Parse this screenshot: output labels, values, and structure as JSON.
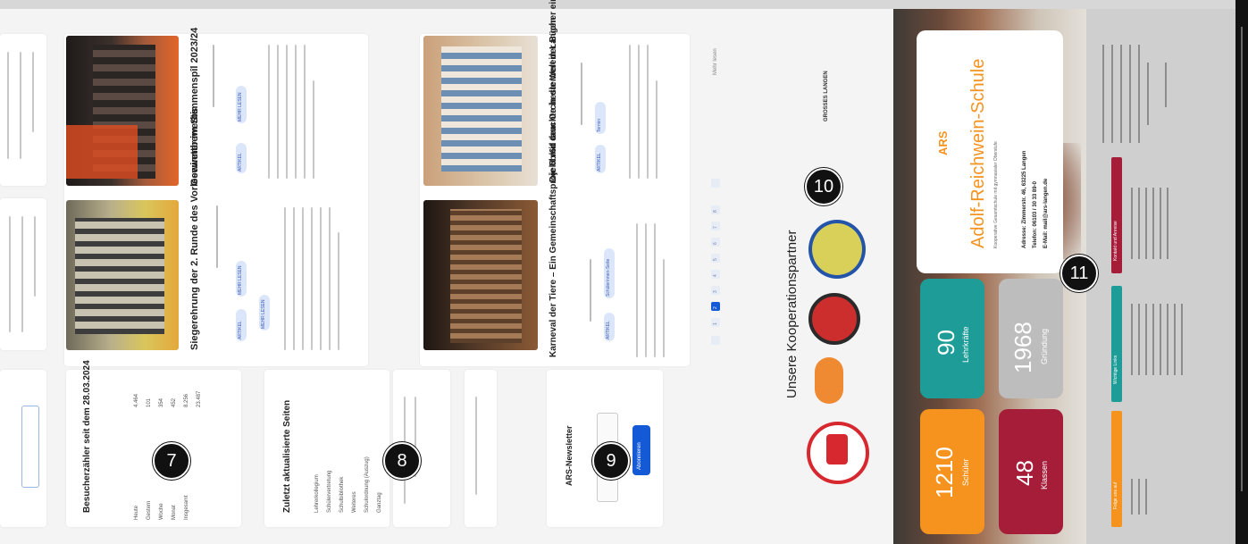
{
  "events": {
    "schulkonzert": {
      "title": "Gewinner im Stimmenspîl 2023/24",
      "tag1": "ARTIKEL",
      "tag2": "MEHR LESEN"
    },
    "verleihung": {
      "title": "Siegerehrung der 2. Runde des Vorlesewettbewerbs",
      "tag1": "ARTIKEL",
      "tag2": "MEHR LESEN",
      "tag3": "MEHR LESEN"
    },
    "karneval": {
      "title": "Karneval der Tiere – Ein Gemeinschaftsprojekt mit dem Orchesterverein Langen",
      "tag1": "ARTIKEL",
      "tag2": "Schülerinnen-Seite"
    },
    "buecher": {
      "title": "Die 5b/6d tauchte in die Welt der Bücher ein",
      "tag1": "ARTIKEL",
      "tag2": "Termin"
    }
  },
  "sidebar": {
    "visitors_title": "Besucherzähler seit dem 28.03.2024",
    "visitors": [
      {
        "label": "Heute",
        "value": "4.464"
      },
      {
        "label": "Gestern",
        "value": "101"
      },
      {
        "label": "Woche",
        "value": "354"
      },
      {
        "label": "Monat",
        "value": "452"
      },
      {
        "label": "Insgesamt",
        "value": "8.256"
      },
      {
        "label": "",
        "value": "23.487"
      }
    ],
    "updated_title": "Zuletzt aktualisierte Seiten",
    "updated": [
      "Lehrerkollegium",
      "Schülervertretung",
      "Schulbibliothek",
      "Weiteres",
      "Schulordnung (Auszug)",
      "Ganztag"
    ],
    "newsletter_title": "ARS-Newsletter",
    "newsletter_button": "Abonnieren"
  },
  "pagination": {
    "pages": [
      "1",
      "2",
      "3",
      "4",
      "5",
      "6",
      "7",
      "8"
    ],
    "active": "2"
  },
  "more_label": "Mehr lesen",
  "partners": {
    "title": "Unsere Kooperationspartner",
    "logo_text": "GROSSES LANGEN"
  },
  "footer": {
    "school_name": "Adolf-Reichwein-Schule",
    "school_sub": "Kooperative Gesamtschule mit gymnasialer Oberstufe",
    "address": "Adresse: Zimmerstr. 46, 63225 Langen",
    "phone": "Telefon: 06103 / 30 33 89-0",
    "email": "E-Mail: mail@ars-langen.de",
    "logo_mark": "ARS",
    "stats": [
      {
        "value": "1210",
        "label": "Schüler"
      },
      {
        "value": "48",
        "label": "Klassen"
      },
      {
        "value": "90",
        "label": "Lehrkräfte"
      },
      {
        "value": "1968",
        "label": "Gründung"
      }
    ],
    "pills": [
      "Folge uns auf",
      "Wichtige Links",
      "Kontakt und Anreise"
    ]
  },
  "markers": [
    "7",
    "8",
    "9",
    "10",
    "11"
  ],
  "colors": {
    "orange": "#f5931e",
    "red": "#a61d3a",
    "teal": "#1e9d98",
    "gray": "#bdbdbd",
    "blue": "#1459d6"
  }
}
